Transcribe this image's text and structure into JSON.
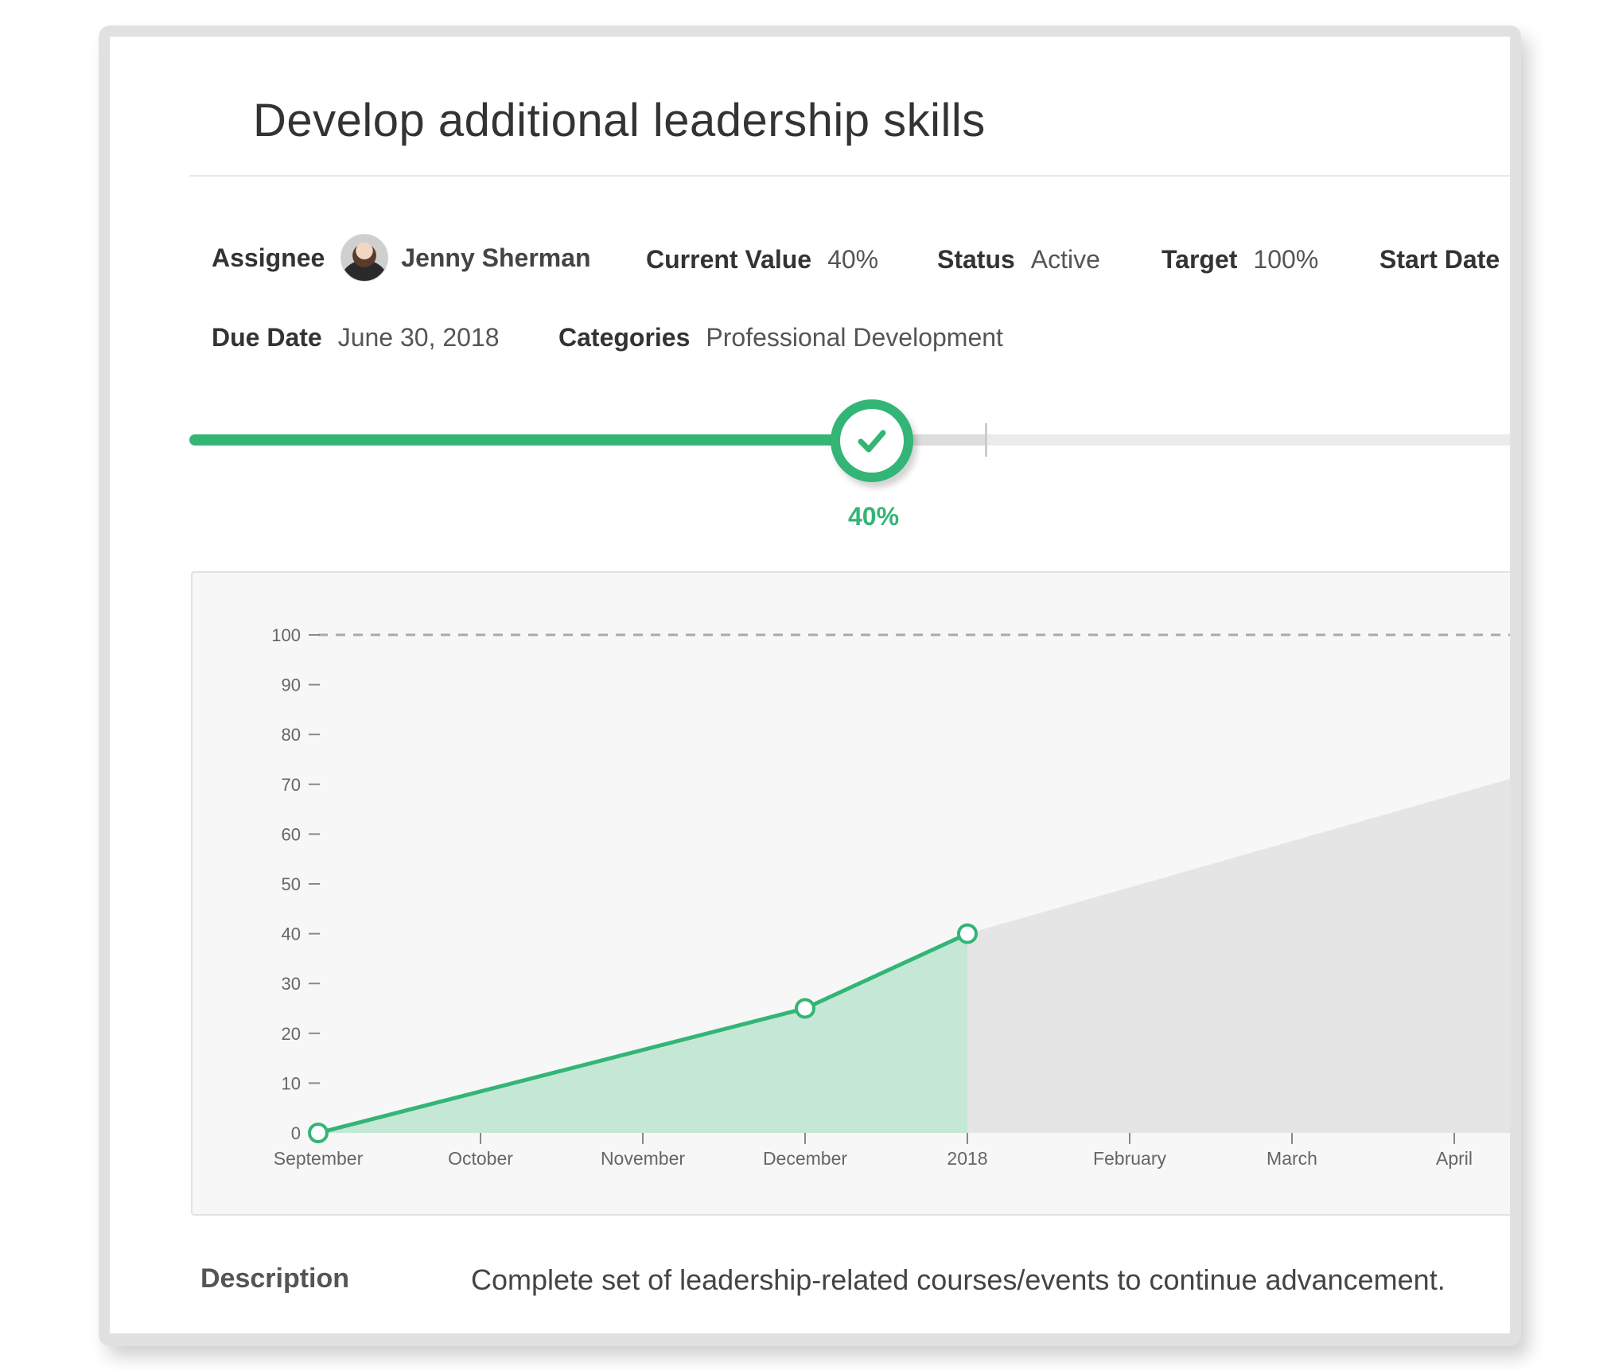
{
  "goal": {
    "title": "Develop additional leadership skills"
  },
  "fields": {
    "assignee_label": "Assignee",
    "assignee_name": "Jenny Sherman",
    "current_value_label": "Current Value",
    "current_value": "40%",
    "status_label": "Status",
    "status": "Active",
    "target_label": "Target",
    "target": "100%",
    "start_date_label": "Start Date",
    "due_date_label": "Due Date",
    "due_date": "June 30, 2018",
    "categories_label": "Categories",
    "categories": "Professional Development"
  },
  "progress": {
    "value_fraction": 0.4,
    "label": "40%"
  },
  "colors": {
    "accent": "#33b576",
    "area_fill": "#c5e7d6",
    "projection_fill": "#e5e5e5"
  },
  "chart_data": {
    "type": "area",
    "x_ticks": [
      "September",
      "October",
      "November",
      "December",
      "2018",
      "February",
      "March",
      "April"
    ],
    "y_ticks": [
      0,
      10,
      20,
      30,
      40,
      50,
      60,
      70,
      80,
      90,
      100
    ],
    "ylim": [
      0,
      100
    ],
    "target_line": 100,
    "series": [
      {
        "x": [
          "September",
          "December",
          "2018"
        ],
        "y": [
          0,
          25,
          40
        ]
      }
    ],
    "grid": false
  },
  "description": {
    "label": "Description",
    "text": "Complete set of leadership-related courses/events to continue advancement."
  }
}
